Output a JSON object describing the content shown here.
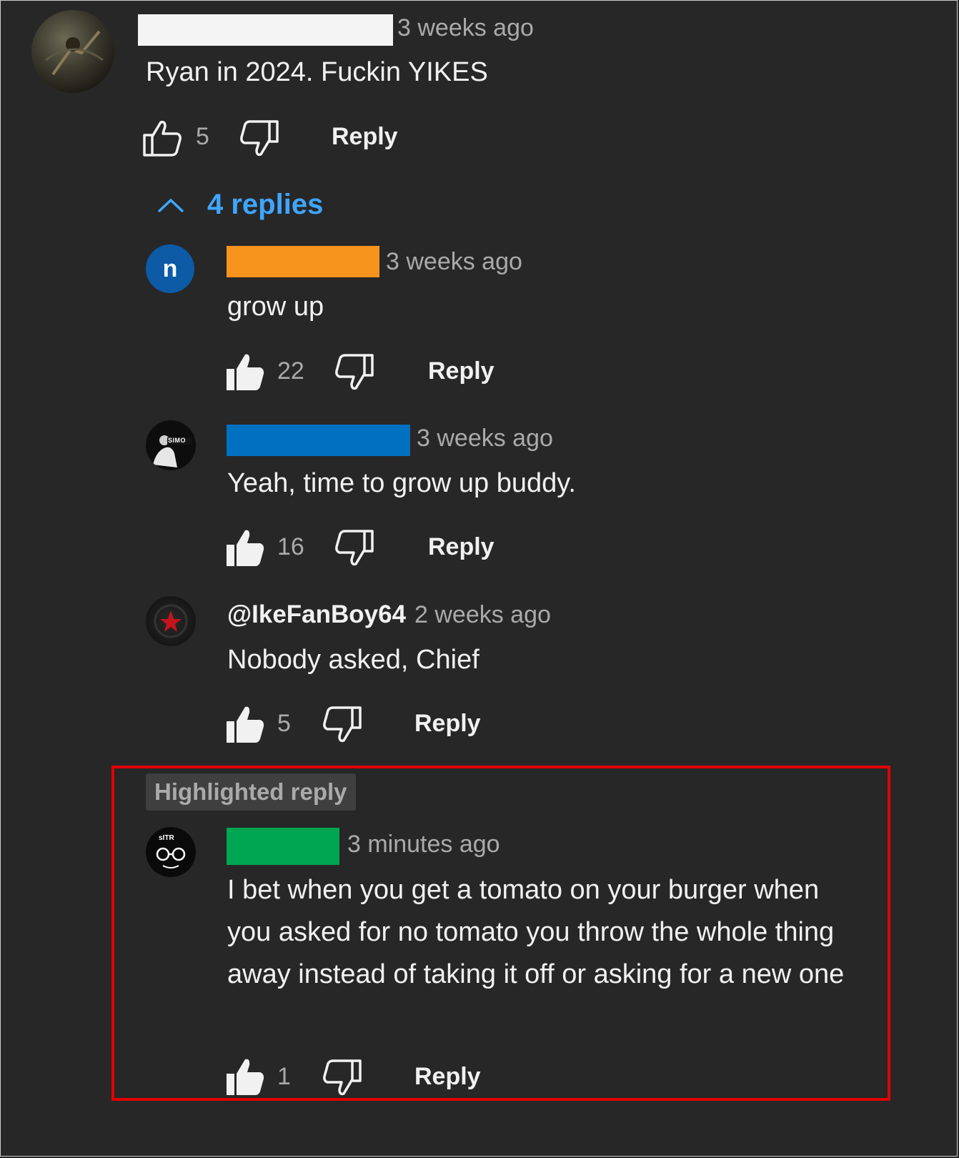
{
  "comments": [
    {
      "timestamp": "3 weeks ago",
      "text": "Ryan in 2024. Fuckin YIKES",
      "likes": "5",
      "reply_label": "Reply",
      "name_redaction_color": "#f4f4f4"
    }
  ],
  "replies_toggle": {
    "label": "4 replies",
    "icon": "chevron-up-icon"
  },
  "replies": [
    {
      "avatar_letter": "n",
      "avatar_color": "#0d5aa7",
      "name_redaction_color": "#f7941d",
      "timestamp": "3 weeks ago",
      "text": "grow up",
      "likes": "22",
      "reply_label": "Reply"
    },
    {
      "name_redaction_color": "#0070c0",
      "avatar_label": "SIMO",
      "timestamp": "3 weeks ago",
      "text": "Yeah, time to grow up buddy.",
      "likes": "16",
      "reply_label": "Reply"
    },
    {
      "author": "@IkeFanBoy64",
      "timestamp": "2 weeks ago",
      "text": "Nobody asked, Chief",
      "likes": "5",
      "reply_label": "Reply"
    },
    {
      "badge": "Highlighted reply",
      "name_redaction_color": "#00a651",
      "avatar_label": "sITR",
      "timestamp": "3 minutes ago",
      "text": "I bet when you get a tomato on your burger when you asked for no tomato you throw the whole thing away instead of taking it off or asking for a new one",
      "likes": "1",
      "reply_label": "Reply",
      "highlight_color": "#e00000"
    }
  ]
}
